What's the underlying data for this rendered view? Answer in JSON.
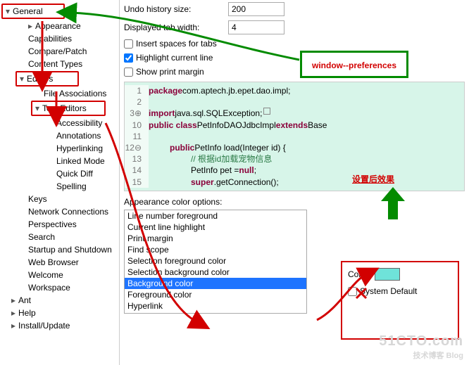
{
  "tree": {
    "general": "General",
    "appearance": "Appearance",
    "capabilities": "Capabilities",
    "comparePatch": "Compare/Patch",
    "contentTypes": "Content Types",
    "editors": "Editors",
    "fileAssociations": "File Associations",
    "textEditors": "Text Editors",
    "accessibility": "Accessibility",
    "annotations": "Annotations",
    "hyperlinking": "Hyperlinking",
    "linkedMode": "Linked Mode",
    "quickDiff": "Quick Diff",
    "spelling": "Spelling",
    "keys": "Keys",
    "networkConn": "Network Connections",
    "perspectives": "Perspectives",
    "search": "Search",
    "startup": "Startup and Shutdown",
    "webBrowser": "Web Browser",
    "welcome": "Welcome",
    "workspace": "Workspace",
    "ant": "Ant",
    "help": "Help",
    "install": "Install/Update"
  },
  "fields": {
    "undoLabel": "Undo history size:",
    "undoVal": "200",
    "tabWidthLabel": "Displayed tab width:",
    "tabWidthVal": "4",
    "insertSpaces": "Insert spaces for tabs",
    "highlightLine": "Highlight current line",
    "showPrintMargin": "Show print margin"
  },
  "code": {
    "l1n": "1",
    "l1a": "package",
    "l1b": " com.aptech.jb.epet.dao.impl;",
    "l2n": "2",
    "l3n": "3",
    "l3a": "import",
    "l3b": " java.sql.SQLException;",
    "l10n": "10",
    "l10a": "public class",
    "l10b": " PetInfoDAOJdbcImpl ",
    "l10c": "extends",
    "l10d": " Base",
    "l11n": "11",
    "l12n": "12",
    "l12a": "public",
    "l12b": " PetInfo load(Integer id) {",
    "l13n": "13",
    "l13a": "// 根据id加载宠物信息",
    "l14n": "14",
    "l14a": "PetInfo pet = ",
    "l14b": "null",
    "l14c": ";",
    "l15n": "15",
    "l15a": "super",
    "l15b": ".getConnection();"
  },
  "opts": {
    "title": "Appearance color options:",
    "i0": "Line number foreground",
    "i1": "Current line highlight",
    "i2": "Print margin",
    "i3": "Find scope",
    "i4": "Selection foreground color",
    "i5": "Selection background color",
    "i6": "Background color",
    "i7": "Foreground color",
    "i8": "Hyperlink",
    "colorLabel": "Color:",
    "sysDefault": "System Default",
    "swatch": "#6fe3d9"
  },
  "annot": {
    "callout": "window--preferences",
    "noteCn": "设置后效果"
  },
  "watermark": {
    "big": "51CTO.com",
    "sm": "技术博客    Blog"
  }
}
